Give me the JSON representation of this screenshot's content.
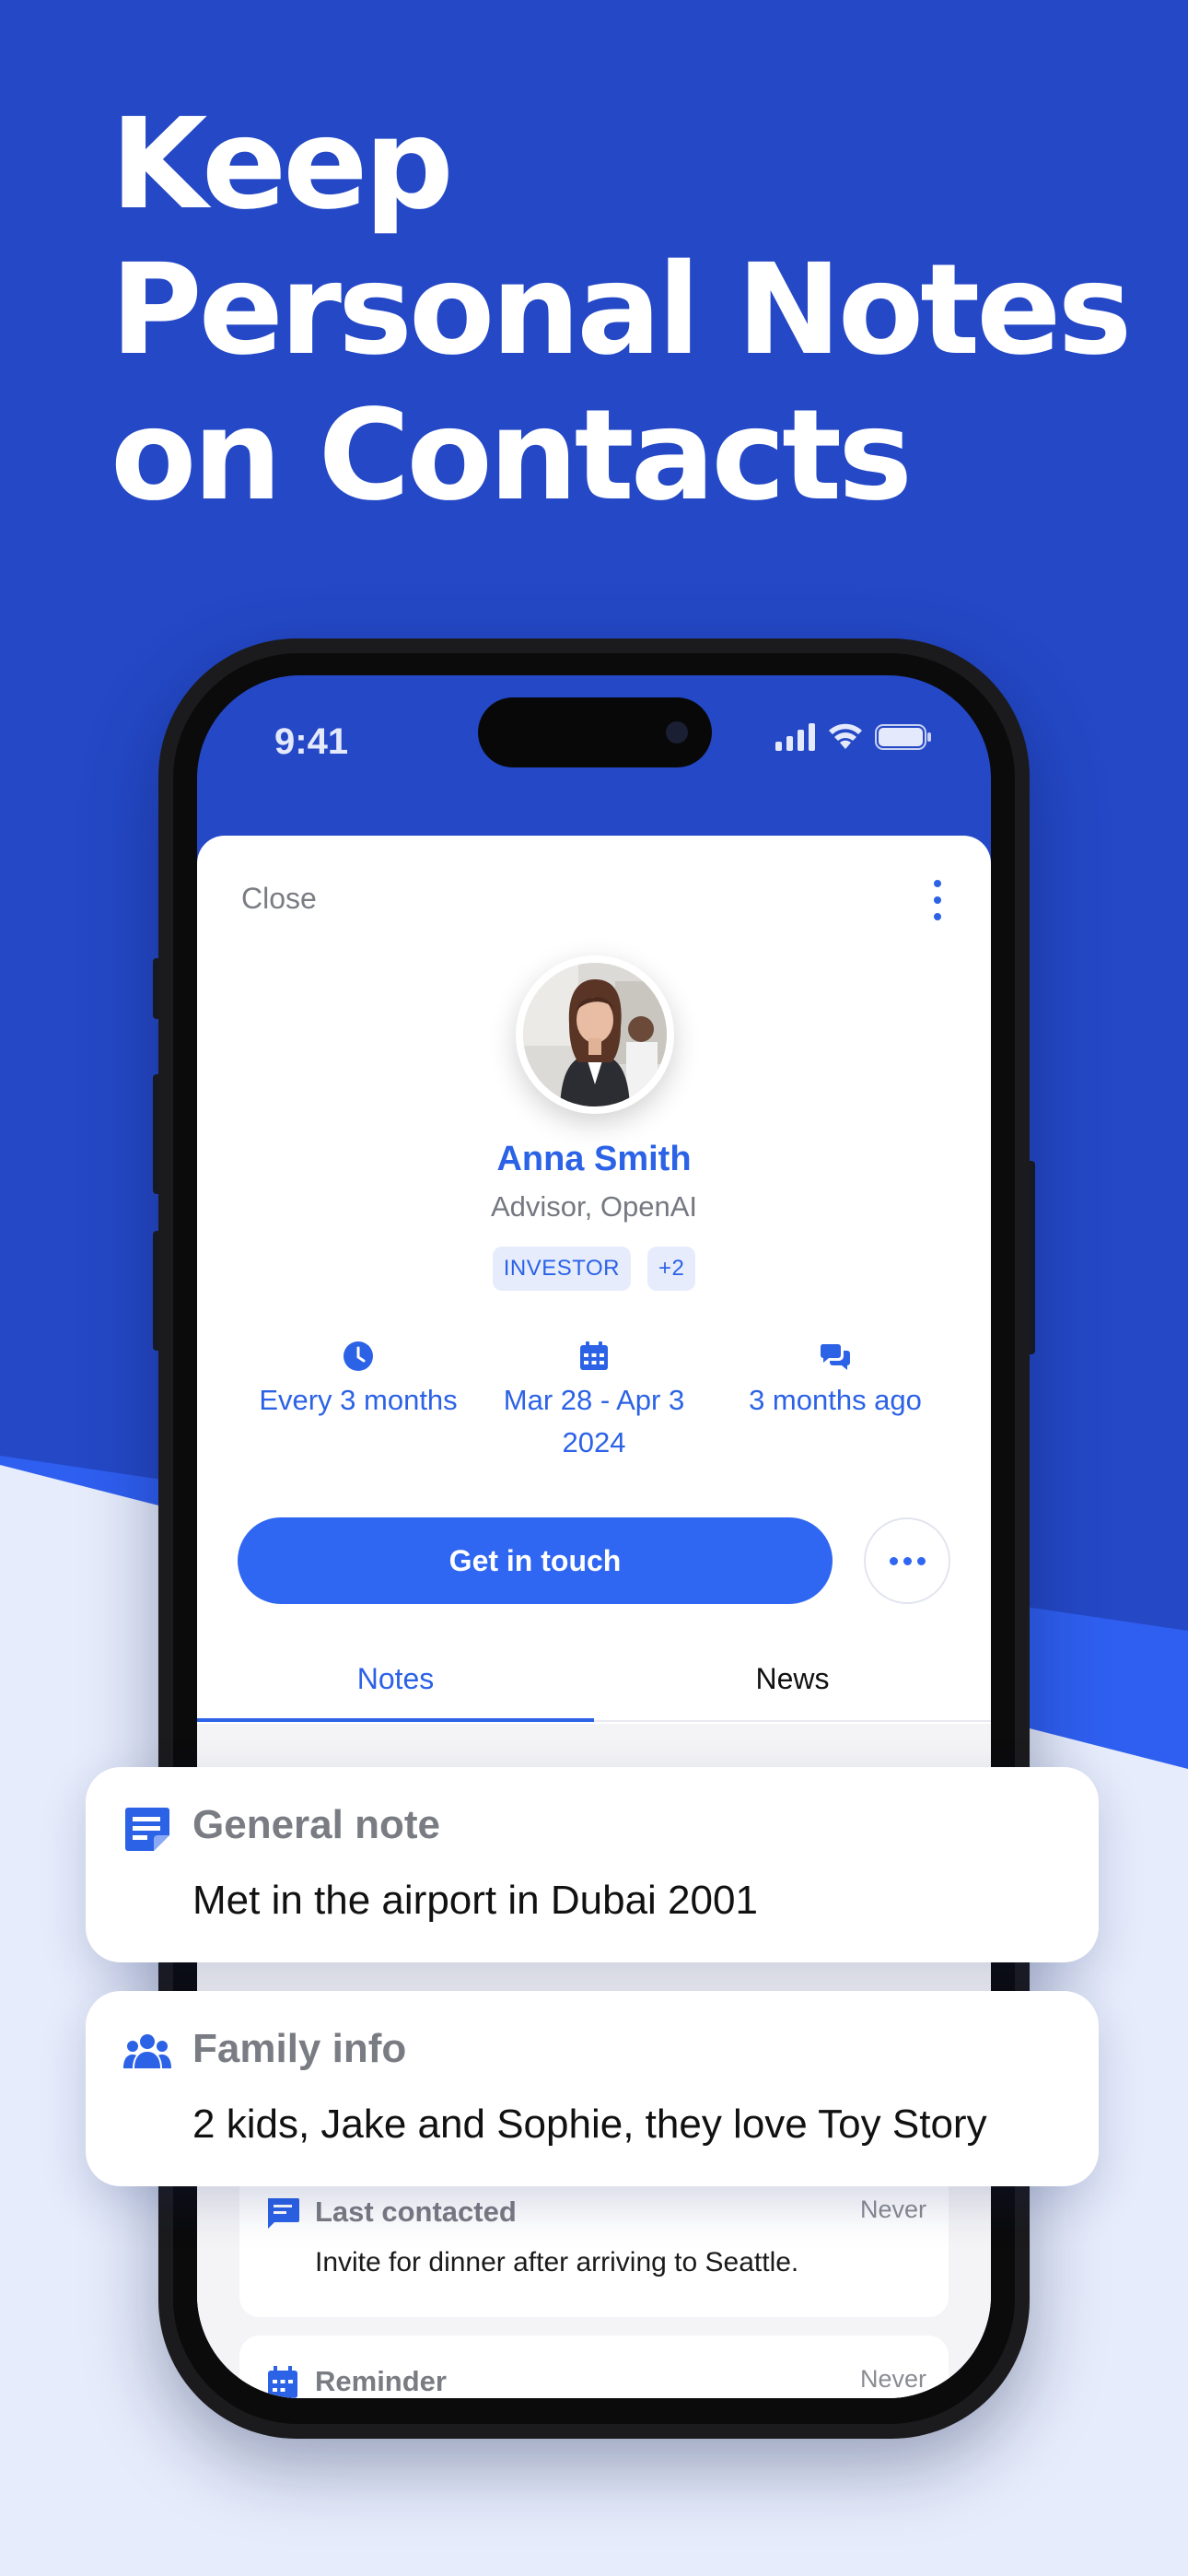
{
  "headline": {
    "line1": "Keep",
    "line2": "Personal Notes",
    "line3": "on Contacts"
  },
  "status_bar": {
    "time": "9:41",
    "icons": [
      "signal-icon",
      "wifi-icon",
      "battery-icon"
    ]
  },
  "contact": {
    "close_label": "Close",
    "name": "Anna Smith",
    "role": "Advisor, OpenAI",
    "tags": [
      "INVESTOR",
      "+2"
    ],
    "stats": [
      {
        "icon": "clock-icon",
        "line1": "Every 3 months",
        "line2": ""
      },
      {
        "icon": "calendar-icon",
        "line1": "Mar 28 - Apr 3",
        "line2": "2024"
      },
      {
        "icon": "chat-icon",
        "line1": "3 months ago",
        "line2": ""
      }
    ],
    "cta_label": "Get in touch",
    "tabs": {
      "active": "Notes",
      "inactive": "News"
    }
  },
  "notes": [
    {
      "icon": "chat-icon",
      "title": "Last contacted",
      "value": "Never",
      "body": "Invite for dinner after arriving to Seattle."
    },
    {
      "icon": "calendar-icon",
      "title": "Reminder",
      "value": "Never",
      "body": ""
    }
  ],
  "floating_cards": [
    {
      "icon": "note-icon",
      "title": "General note",
      "body": "Met in the airport in Dubai 2001"
    },
    {
      "icon": "people-icon",
      "title": "Family info",
      "body": "2 kids, Jake and Sophie, they love Toy Story"
    }
  ],
  "colors": {
    "brand_blue": "#2448c6",
    "accent_blue": "#2b62e6",
    "background_light": "#e6ecfb"
  }
}
